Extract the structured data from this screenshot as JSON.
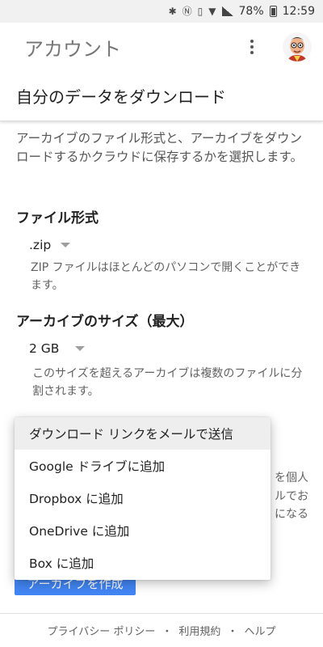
{
  "status_bar": {
    "battery_percent": "78%",
    "time": "12:59"
  },
  "app_bar": {
    "title": "アカウント"
  },
  "section": {
    "title": "自分のデータをダウンロード"
  },
  "intro": {
    "text": "アーカイブのファイル形式と、アーカイブをダウンロードするかクラウドに保存するかを選択します。"
  },
  "file_format": {
    "label": "ファイル形式",
    "value": ".zip",
    "helper": "ZIP ファイルはほとんどのパソコンで開くことができます。"
  },
  "archive_size": {
    "label": "アーカイブのサイズ（最大）",
    "value": "2 GB",
    "helper": "このサイズを超えるアーカイブは複数のファイルに分割されます。"
  },
  "partial": {
    "line1": "を個人",
    "line2": "ルでお",
    "line3": "になる"
  },
  "create_button": {
    "label": "アーカイブを作成"
  },
  "delivery_menu": {
    "items": [
      "ダウンロード リンクをメールで送信",
      "Google ドライブに追加",
      "Dropbox に追加",
      "OneDrive に追加",
      "Box に追加"
    ],
    "highlighted_index": 0
  },
  "footer": {
    "privacy": "プライバシー ポリシー",
    "terms": "利用規約",
    "help": "ヘルプ",
    "separator": "・"
  }
}
